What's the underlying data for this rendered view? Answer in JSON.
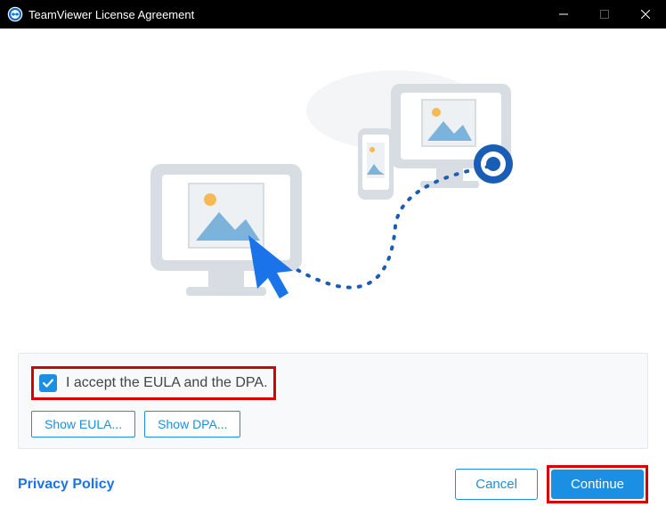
{
  "titlebar": {
    "title": "TeamViewer License Agreement"
  },
  "eula": {
    "accept_label": "I accept the EULA and the DPA.",
    "checked": true,
    "show_eula_label": "Show EULA...",
    "show_dpa_label": "Show DPA..."
  },
  "footer": {
    "privacy_label": "Privacy Policy",
    "cancel_label": "Cancel",
    "continue_label": "Continue"
  },
  "highlights": {
    "checkbox_row": true,
    "continue": true
  }
}
